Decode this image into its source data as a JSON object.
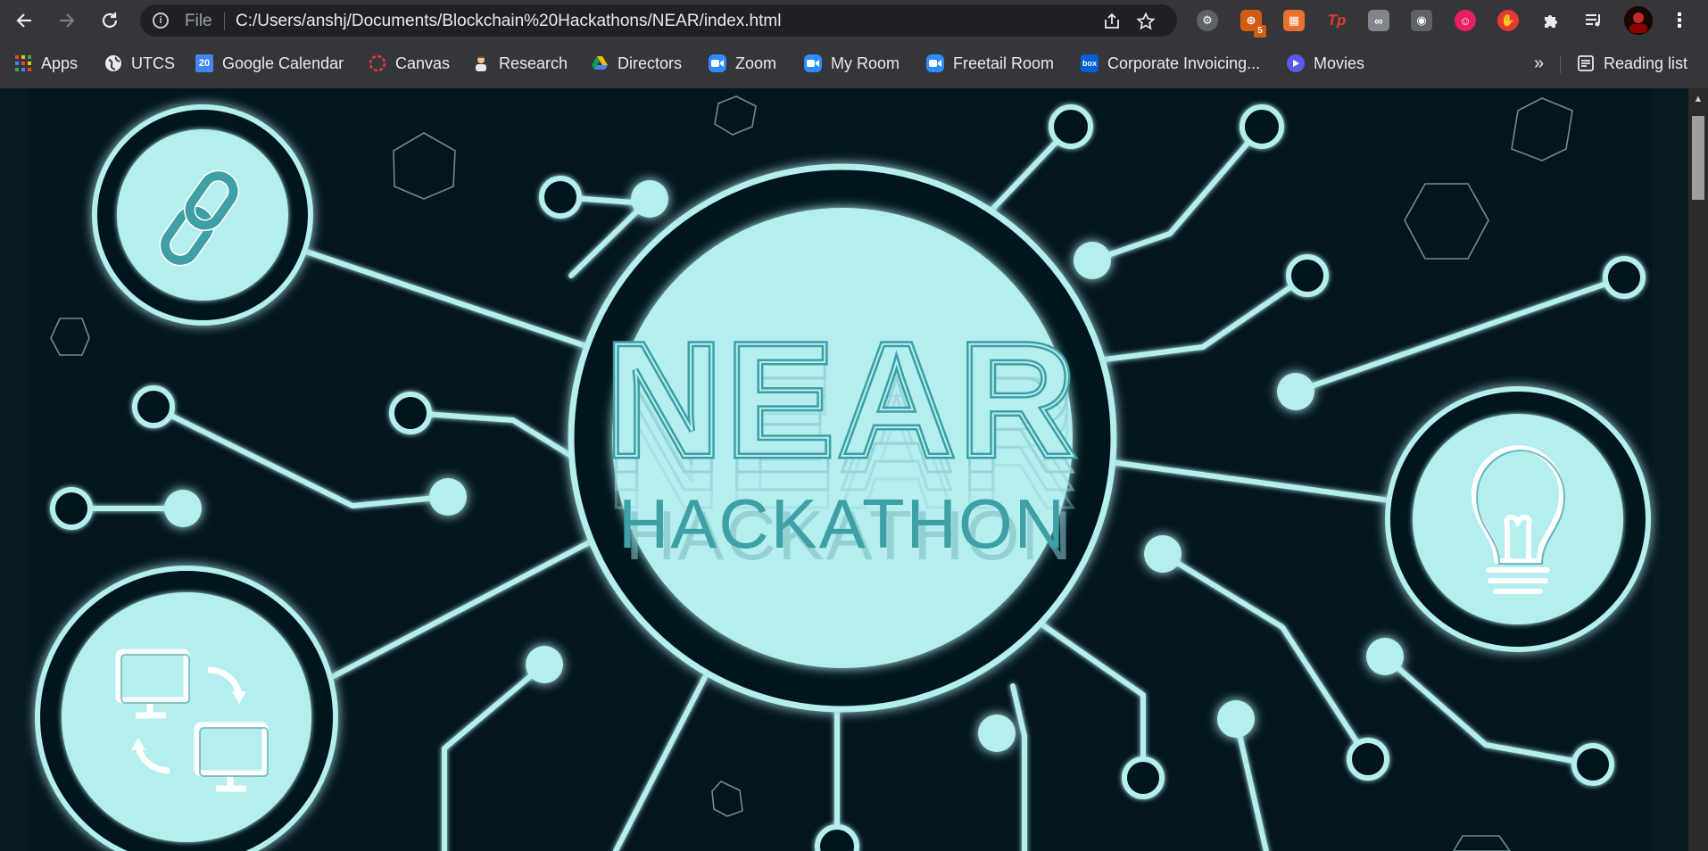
{
  "browser": {
    "back_icon": "arrow-left-icon",
    "forward_icon": "arrow-right-icon",
    "reload_icon": "reload-icon",
    "omnibox": {
      "info_icon": "info-icon",
      "scheme_label": "File",
      "url": "C:/Users/anshj/Documents/Blockchain%20Hackathons/NEAR/index.html",
      "share_icon": "share-icon",
      "bookmark_icon": "star-icon"
    },
    "extension_badge": "5",
    "bookmarks": [
      {
        "label": "Apps",
        "icon": "apps-grid-icon",
        "color": "#ea4335"
      },
      {
        "label": "UTCS",
        "icon": "globe-icon",
        "color": "#e8eaed"
      },
      {
        "label": "Google Calendar",
        "icon": "calendar-icon",
        "color": "#4285f4",
        "icon_text": "20"
      },
      {
        "label": "Canvas",
        "icon": "canvas-icon",
        "color": "#e03a3e"
      },
      {
        "label": "Research",
        "icon": "scientist-icon",
        "color": "#b06a3a"
      },
      {
        "label": "Directors",
        "icon": "drive-icon",
        "color": "#0f9d58"
      },
      {
        "label": "Zoom",
        "icon": "zoom-icon",
        "color": "#2d8cff"
      },
      {
        "label": "My Room",
        "icon": "zoom-icon",
        "color": "#2d8cff"
      },
      {
        "label": "Freetail Room",
        "icon": "zoom-icon",
        "color": "#2d8cff"
      },
      {
        "label": "Corporate Invoicing...",
        "icon": "box-icon",
        "color": "#0061d5",
        "icon_text": "box"
      },
      {
        "label": "Movies",
        "icon": "play-icon",
        "color": "#5b5bea"
      }
    ],
    "more_bookmarks": "»",
    "reading_list": "Reading list"
  },
  "page": {
    "banner_title": "NEAR",
    "banner_subtitle": "HACKATHON"
  },
  "colors": {
    "background": "#071a22",
    "neon": "#b4eeee",
    "text_teal": "#3e9fa5"
  }
}
